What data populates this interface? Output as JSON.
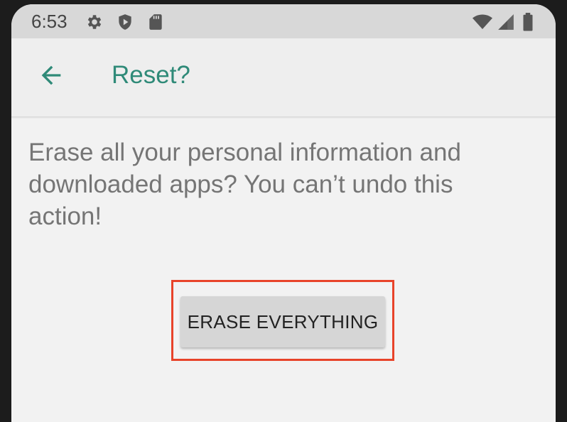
{
  "status_bar": {
    "time": "6:53",
    "icons": [
      "gear-icon",
      "shield-play-icon",
      "sd-card-icon",
      "wifi-icon",
      "signal-icon",
      "battery-icon"
    ]
  },
  "app_bar": {
    "back_icon": "arrow-left-icon",
    "title": "Reset?"
  },
  "content": {
    "message": "Erase all your personal information and downloaded apps? You can’t undo this action!",
    "erase_button_label": "ERASE EVERYTHING"
  },
  "colors": {
    "accent": "#2f8a78",
    "highlight": "#e8432a",
    "button_bg": "#d6d6d6",
    "text_secondary": "#757575"
  }
}
